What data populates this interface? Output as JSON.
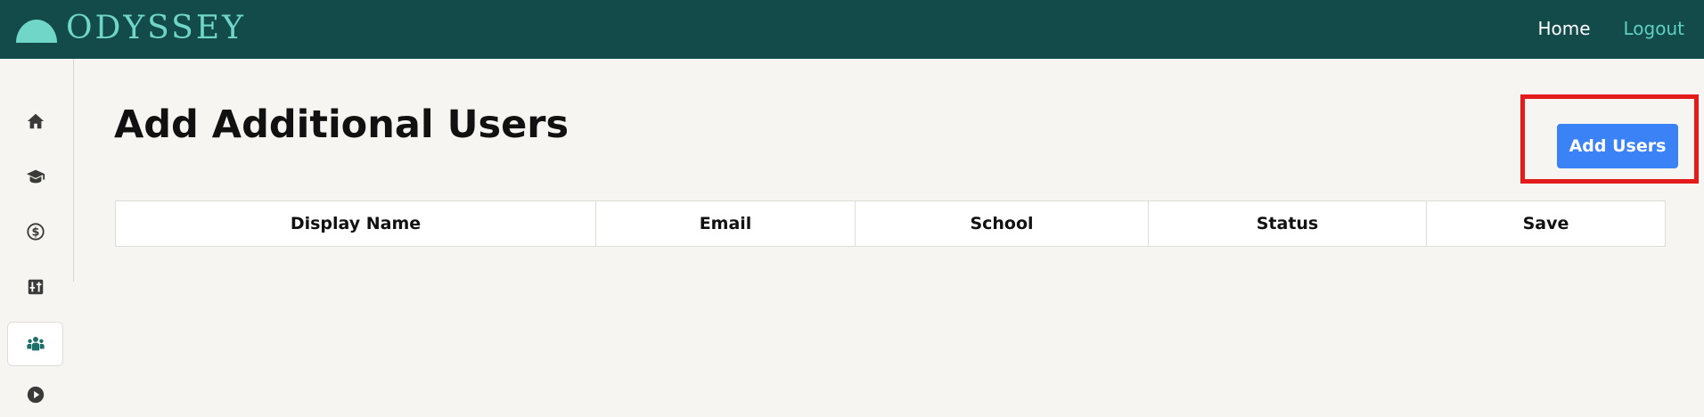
{
  "header": {
    "logo_text": "ODYSSEY",
    "nav": [
      {
        "label": "Home"
      },
      {
        "label": "Logout"
      }
    ]
  },
  "sidebar": {
    "items": [
      {
        "icon": "home-icon",
        "active": false
      },
      {
        "icon": "graduation-cap-icon",
        "active": false
      },
      {
        "icon": "dollar-circle-icon",
        "active": false
      },
      {
        "icon": "sliders-icon",
        "active": false
      },
      {
        "icon": "users-icon",
        "active": true
      },
      {
        "icon": "play-circle-icon",
        "active": false
      }
    ]
  },
  "main": {
    "title": "Add Additional Users",
    "add_button_label": "Add Users",
    "table": {
      "columns": [
        "Display Name",
        "Email",
        "School",
        "Status",
        "Save"
      ],
      "rows": []
    }
  },
  "colors": {
    "header_bg": "#134b4b",
    "logo": "#6fd6c8",
    "nav_home": "#ffffff",
    "nav_logout": "#5fd0c3",
    "page_bg": "#f6f5f1",
    "primary_button": "#3b82f6",
    "highlight": "#e31b1b",
    "sidebar_icon": "#3a3a3a",
    "sidebar_icon_active": "#1e6e6a"
  }
}
